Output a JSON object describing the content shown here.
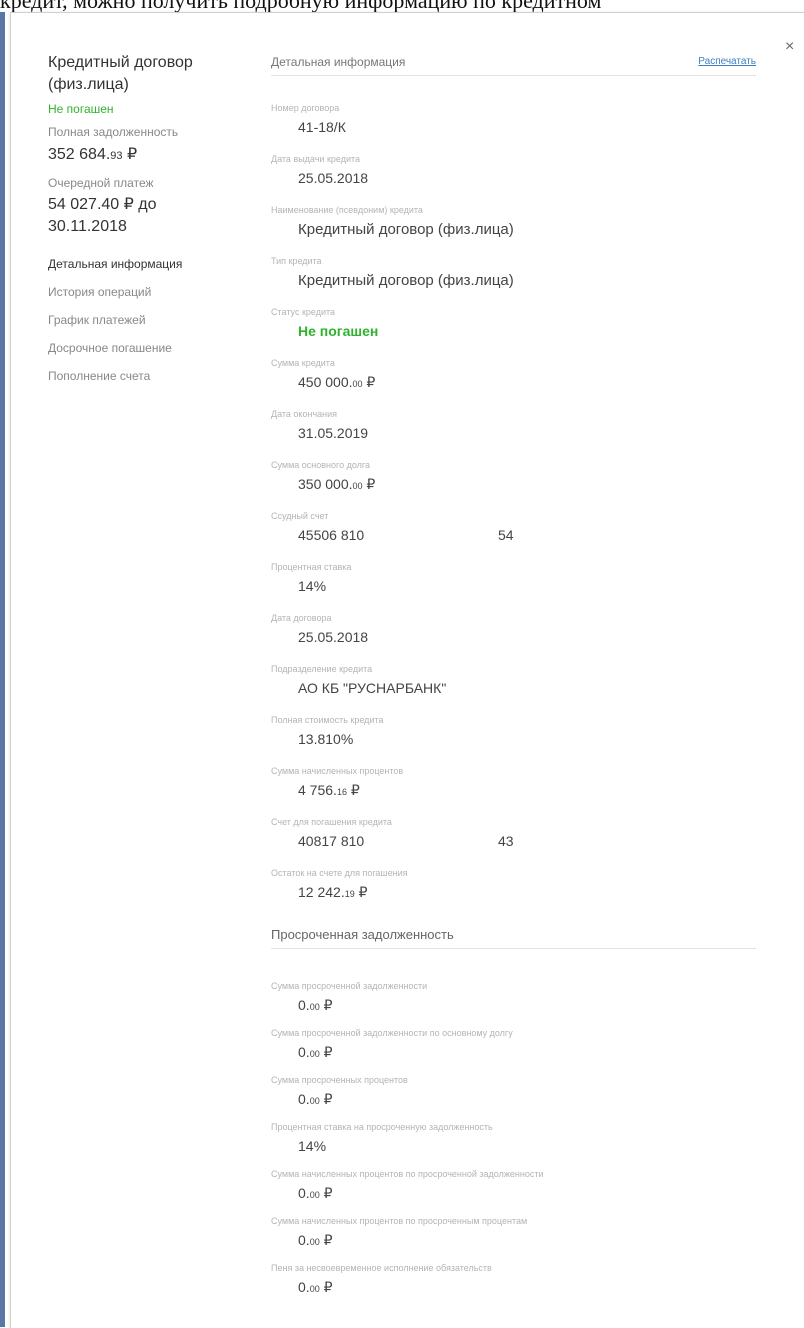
{
  "background_text": "кредит, можно получить подробную информацию по кредитном",
  "close_label": "×",
  "sidebar": {
    "title": "Кредитный договор (физ.лица)",
    "status": "Не погашен",
    "total_debt_label": "Полная задолженность",
    "total_debt_main": "352 684.",
    "total_debt_cents": "93",
    "total_debt_currency": " ₽",
    "next_payment_label": "Очередной платеж",
    "next_payment_value": "54 027.40 ₽ до 30.11.2018",
    "nav": [
      "Детальная информация",
      "История операций",
      "График платежей",
      "Досрочное погашение",
      "Пополнение счета"
    ]
  },
  "main": {
    "section_title": "Детальная информация",
    "print_label": "Распечатать",
    "fields": [
      {
        "label": "Номер договора",
        "value": "41-18/К"
      },
      {
        "label": "Дата выдачи кредита",
        "value": "25.05.2018"
      },
      {
        "label": "Наименование (псевдоним) кредита",
        "value": "Кредитный договор (физ.лица)"
      },
      {
        "label": "Тип кредита",
        "value": "Кредитный договор (физ.лица)"
      },
      {
        "label": "Статус кредита",
        "value": "Не погашен"
      },
      {
        "label": "Сумма кредита",
        "value_main": "450 000.",
        "value_cents": "00",
        "value_currency": " ₽"
      },
      {
        "label": "Дата окончания",
        "value": "31.05.2019"
      },
      {
        "label": "Сумма основного долга",
        "value_main": "350 000.",
        "value_cents": "00",
        "value_currency": " ₽"
      },
      {
        "label": "Ссудный счет",
        "value": "45506 810",
        "value_part2": "54"
      },
      {
        "label": "Процентная ставка",
        "value": "14%"
      },
      {
        "label": "Дата договора",
        "value": "25.05.2018"
      },
      {
        "label": "Подразделение кредита",
        "value": "АО КБ \"РУСНАРБАНК\""
      },
      {
        "label": "Полная стоимость кредита",
        "value": "13.810%"
      },
      {
        "label": "Сумма начисленных процентов",
        "value_main": "4 756.",
        "value_cents": "16",
        "value_currency": " ₽"
      },
      {
        "label": "Счет для погашения кредита",
        "value": "40817 810",
        "value_part2": "43"
      },
      {
        "label": "Остаток на счете для погашения",
        "value_main": "12 242.",
        "value_cents": "19",
        "value_currency": " ₽"
      }
    ],
    "overdue_title": "Просроченная задолженность",
    "overdue_fields": [
      {
        "label": "Сумма просроченной задолженности",
        "value_main": "0.",
        "value_cents": "00",
        "value_currency": " ₽"
      },
      {
        "label": "Сумма просроченной задолженности по основному долгу",
        "value_main": "0.",
        "value_cents": "00",
        "value_currency": " ₽"
      },
      {
        "label": "Сумма просроченных процентов",
        "value_main": "0.",
        "value_cents": "00",
        "value_currency": " ₽"
      },
      {
        "label": "Процентная ставка на просроченную задолженность",
        "value": "14%"
      },
      {
        "label": "Сумма начисленных процентов по просроченной задолженности",
        "value_main": "0.",
        "value_cents": "00",
        "value_currency": " ₽"
      },
      {
        "label": "Сумма начисленных процентов по просроченным процентам",
        "value_main": "0.",
        "value_cents": "00",
        "value_currency": " ₽"
      },
      {
        "label": "Пеня за несвоевременное исполнение обязательств",
        "value_main": "0.",
        "value_cents": "00",
        "value_currency": " ₽"
      }
    ]
  }
}
